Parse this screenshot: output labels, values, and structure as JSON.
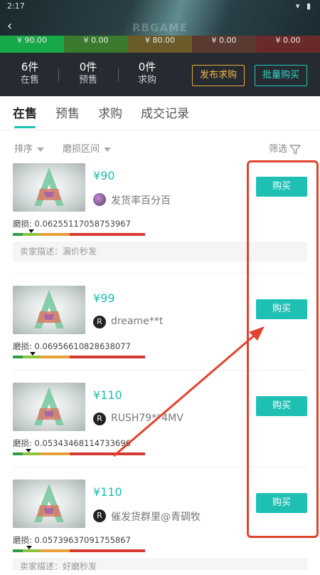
{
  "status": {
    "time": "2:17",
    "icons": "▾ ▮"
  },
  "header": {
    "back_icon": "‹",
    "brand": "RBGAME",
    "price_strip": [
      {
        "label": "¥ 90.00",
        "color": "#17a84a"
      },
      {
        "label": "¥ 0.00",
        "color": "#3a7a2e"
      },
      {
        "label": "¥ 80.00",
        "color": "#6b5b2a"
      },
      {
        "label": "¥ 0.00",
        "color": "#5a3a30"
      },
      {
        "label": "¥ 0.00",
        "color": "#6b2a2a"
      }
    ],
    "stats": [
      {
        "count": "6件",
        "label": "在售"
      },
      {
        "count": "0件",
        "label": "预售"
      },
      {
        "count": "0件",
        "label": "求购"
      }
    ],
    "publish_label": "发布求购",
    "batch_label": "批量购买"
  },
  "tabs": [
    "在售",
    "预售",
    "求购",
    "成交记录"
  ],
  "filters": {
    "sort": "排序",
    "wear_range": "磨损区间",
    "screen": "筛选"
  },
  "listings": [
    {
      "price": "¥90",
      "seller": "发货率百分百",
      "avatar": "photo",
      "wear": "磨损: 0.06255117058753967",
      "wear_value": 0.0626,
      "desc": "卖家描述：漏价秒发",
      "buy_label": "购买"
    },
    {
      "price": "¥99",
      "seller": "dreame**t",
      "avatar": "R",
      "wear": "磨损: 0.06956610828638077",
      "wear_value": 0.0696,
      "desc": "",
      "buy_label": "购买"
    },
    {
      "price": "¥110",
      "seller": "RUSH79**4MV",
      "avatar": "R",
      "wear": "磨损: 0.05343468114733696",
      "wear_value": 0.0534,
      "desc": "",
      "buy_label": "购买"
    },
    {
      "price": "¥110",
      "seller": "催发货群里@青碉牧",
      "avatar": "R",
      "wear": "磨损: 0.05739637091755867",
      "wear_value": 0.0574,
      "desc": "卖家描述：好磨秒发",
      "buy_label": "购买"
    }
  ],
  "colors": {
    "accent": "#1fc0b4",
    "publish": "#f0b54a",
    "annotation": "#e0442f"
  }
}
